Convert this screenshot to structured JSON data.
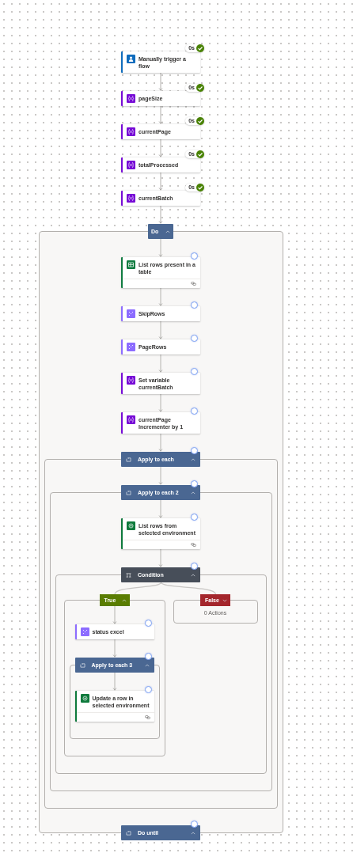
{
  "actions": [
    {
      "kind": "trigger",
      "title": "Manually trigger a flow",
      "completed": true,
      "duration": "0s"
    },
    {
      "kind": "variable",
      "title": "pageSize",
      "completed": true,
      "duration": "0s"
    },
    {
      "kind": "variable",
      "title": "currentPage",
      "completed": true,
      "duration": "0s"
    },
    {
      "kind": "variable",
      "title": "totalProcessed",
      "completed": true,
      "duration": "0s"
    },
    {
      "kind": "variable",
      "title": "currentBatch",
      "completed": true,
      "duration": "0s"
    },
    {
      "kind": "do_until",
      "title": "Do",
      "footer_title": "Do until",
      "completed": false,
      "expanded": true,
      "children": [
        {
          "kind": "excel",
          "title": "List rows present in a table",
          "completed": false
        },
        {
          "kind": "compose",
          "title": "SkipRows",
          "completed": false
        },
        {
          "kind": "compose",
          "title": "PageRows",
          "completed": false
        },
        {
          "kind": "variable",
          "title": "Set variable currentBatch",
          "completed": false
        },
        {
          "kind": "variable",
          "title": "currentPage Incrementer by 1",
          "completed": false
        },
        {
          "kind": "foreach",
          "title": "Apply to each",
          "completed": false,
          "expanded": true,
          "children": [
            {
              "kind": "foreach",
              "title": "Apply to each 2",
              "completed": false,
              "expanded": true,
              "children": [
                {
                  "kind": "dataverse",
                  "title": "List rows from selected environment",
                  "completed": false
                },
                {
                  "kind": "condition",
                  "title": "Condition",
                  "completed": false,
                  "expanded": true,
                  "branches": [
                    {
                      "kind": "true",
                      "label": "True",
                      "expanded": true,
                      "children": [
                        {
                          "kind": "compose",
                          "title": "status excel",
                          "completed": false
                        },
                        {
                          "kind": "foreach",
                          "title": "Apply to each 3",
                          "completed": false,
                          "expanded": true,
                          "children": [
                            {
                              "kind": "dataverse",
                              "title": "Update a row in selected environment",
                              "completed": false
                            }
                          ]
                        }
                      ]
                    },
                    {
                      "kind": "false",
                      "label": "False",
                      "expanded": false,
                      "collapsed_summary": "0 Actions"
                    }
                  ]
                }
              ]
            }
          ]
        }
      ]
    }
  ]
}
